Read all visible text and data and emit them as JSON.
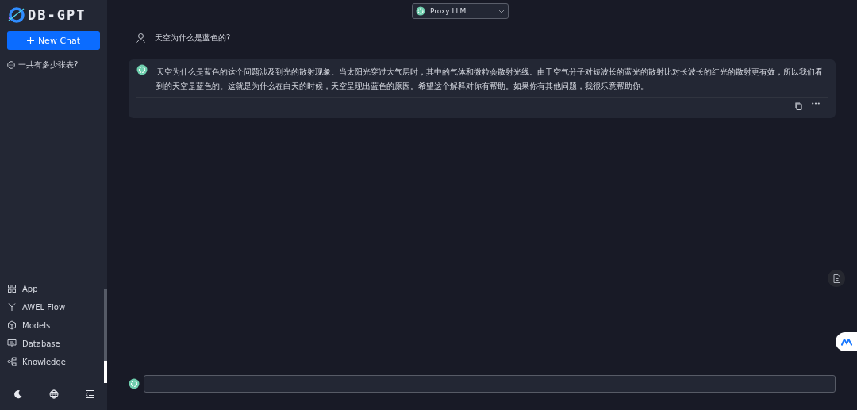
{
  "sidebar": {
    "logo": "DB-GPT",
    "new_chat_button": "New Chat",
    "history": [
      {
        "label": "一共有多少张表?"
      }
    ],
    "nav_items": [
      {
        "label": "App",
        "kind": "grid"
      },
      {
        "label": "AWEL Flow",
        "kind": "flow"
      },
      {
        "label": "Models",
        "kind": "cube"
      },
      {
        "label": "Database",
        "kind": "monitor"
      },
      {
        "label": "Knowledge",
        "kind": "share"
      }
    ]
  },
  "model_selector": {
    "value": "Proxy LLM"
  },
  "messages": [
    {
      "kind": "user",
      "text": "天空为什么是蓝色的?"
    },
    {
      "kind": "answer",
      "text": "天空为什么是蓝色的这个问题涉及到光的散射现象。当太阳光穿过大气层时，其中的气体和微粒会散射光线。由于空气分子对短波长的蓝光的散射比对长波长的红光的散射更有效，所以我们看到的天空是蓝色的。这就是为什么在白天的时候，天空呈现出蓝色的原因。希望这个解释对你有帮助。如果你有其他问题，我很乐意帮助你。"
    }
  ]
}
